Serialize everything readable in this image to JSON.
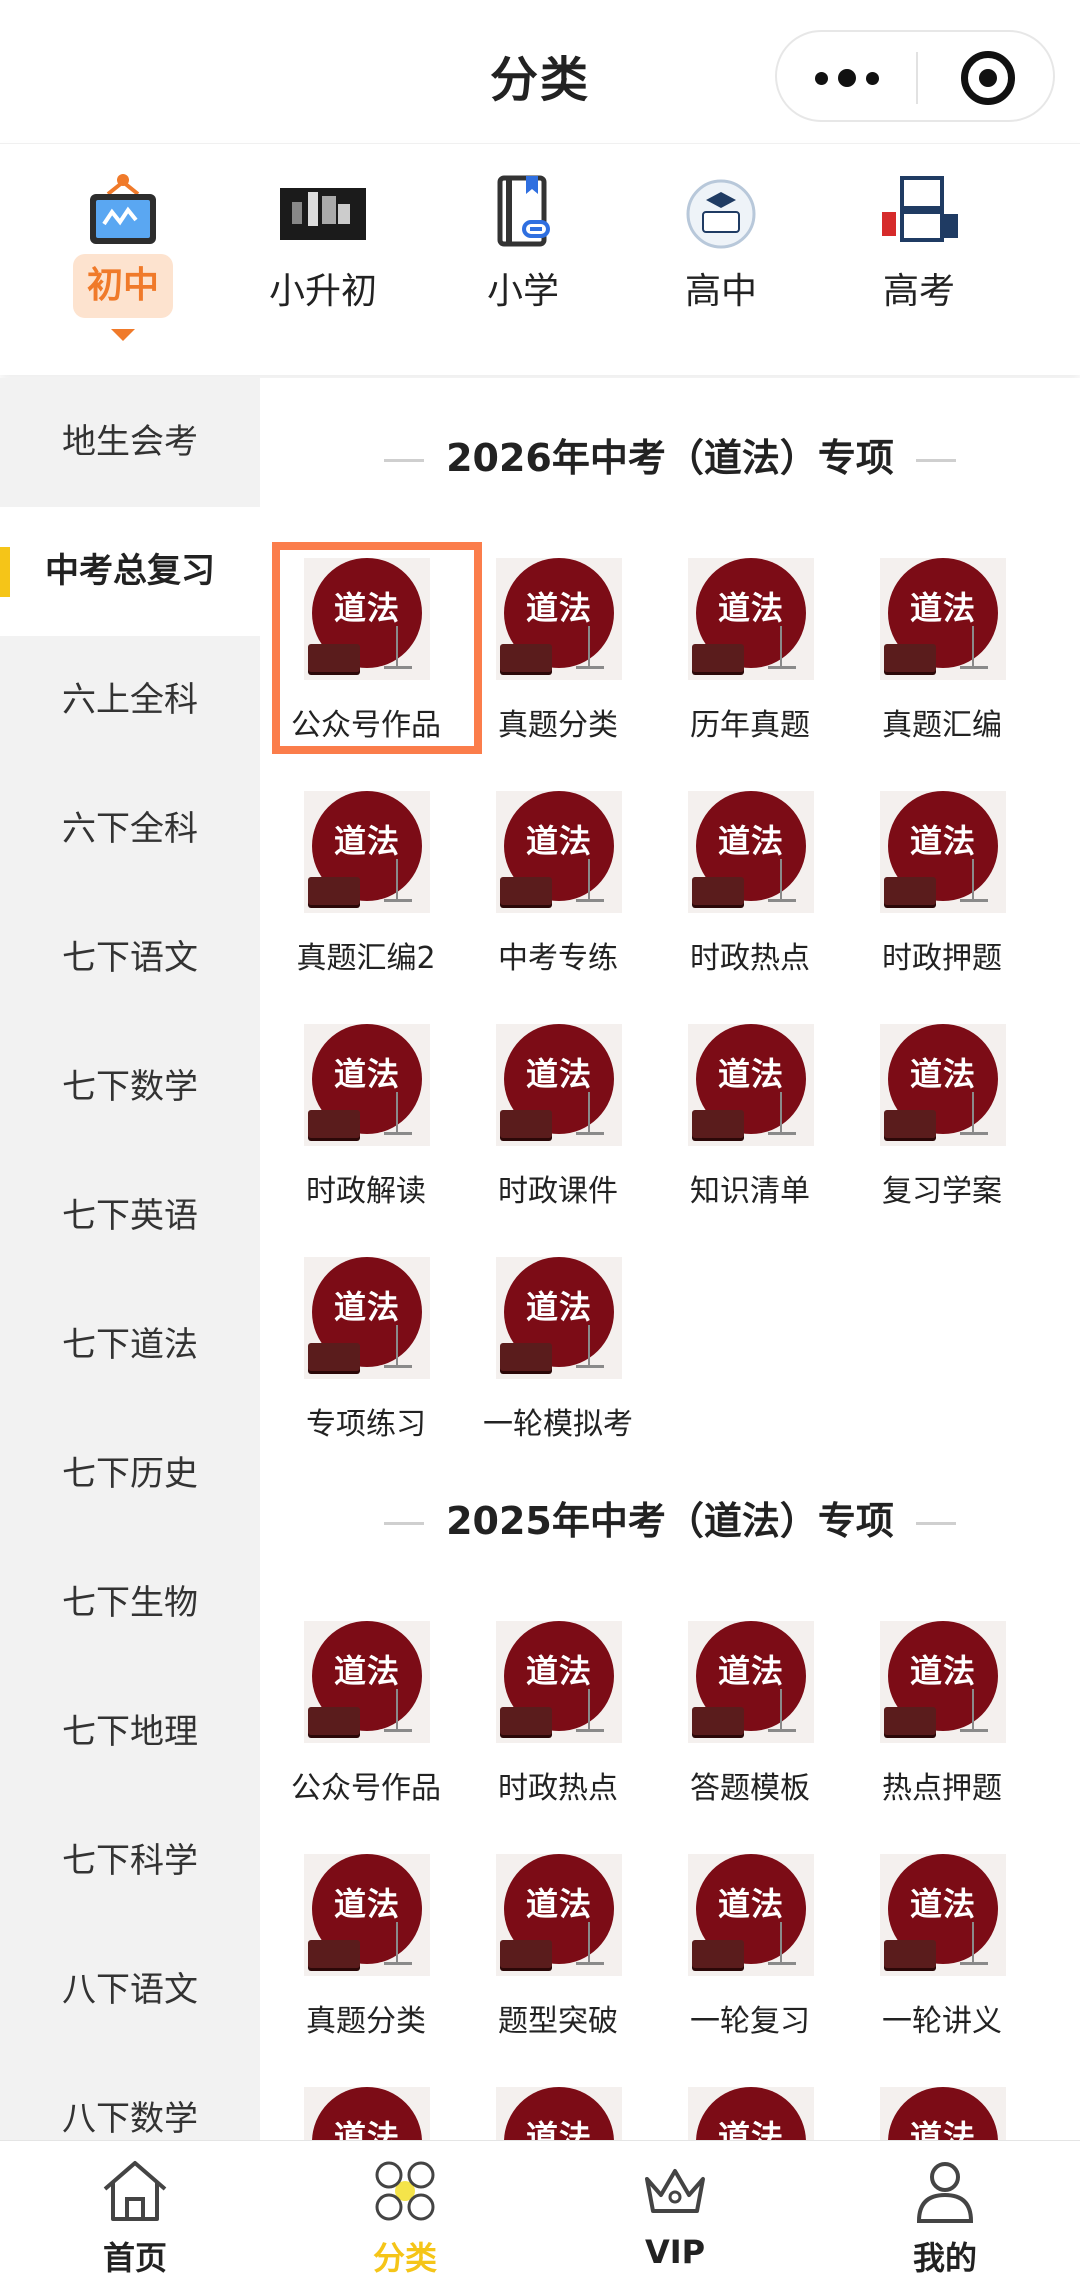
{
  "header": {
    "title": "分类"
  },
  "levels": [
    {
      "label": "初中"
    },
    {
      "label": "小升初"
    },
    {
      "label": "小学"
    },
    {
      "label": "高中"
    },
    {
      "label": "高考"
    }
  ],
  "sidebar": {
    "items": [
      "地生会考",
      "中考总复习",
      "六上全科",
      "六下全科",
      "七下语文",
      "七下数学",
      "七下英语",
      "七下道法",
      "七下历史",
      "七下生物",
      "七下地理",
      "七下科学",
      "八下语文",
      "八下数学"
    ]
  },
  "thumb_text": "道法",
  "sections": [
    {
      "title": "2026年中考（道法）专项",
      "items": [
        "公众号作品",
        "真题分类",
        "历年真题",
        "真题汇编",
        "真题汇编2",
        "中考专练",
        "时政热点",
        "时政押题",
        "时政解读",
        "时政课件",
        "知识清单",
        "复习学案",
        "专项练习",
        "一轮模拟考"
      ]
    },
    {
      "title": "2025年中考（道法）专项",
      "items": [
        "公众号作品",
        "时政热点",
        "答题模板",
        "热点押题",
        "真题分类",
        "题型突破",
        "一轮复习",
        "一轮讲义",
        "",
        "",
        "",
        ""
      ]
    }
  ],
  "tabs": [
    {
      "label": "首页"
    },
    {
      "label": "分类"
    },
    {
      "label": "VIP"
    },
    {
      "label": "我的"
    }
  ],
  "colors": {
    "accent": "#f5c518",
    "level_active": "#f07a2a",
    "highlight": "#fb7d4b",
    "thumb_disc": "#7c0c16"
  }
}
